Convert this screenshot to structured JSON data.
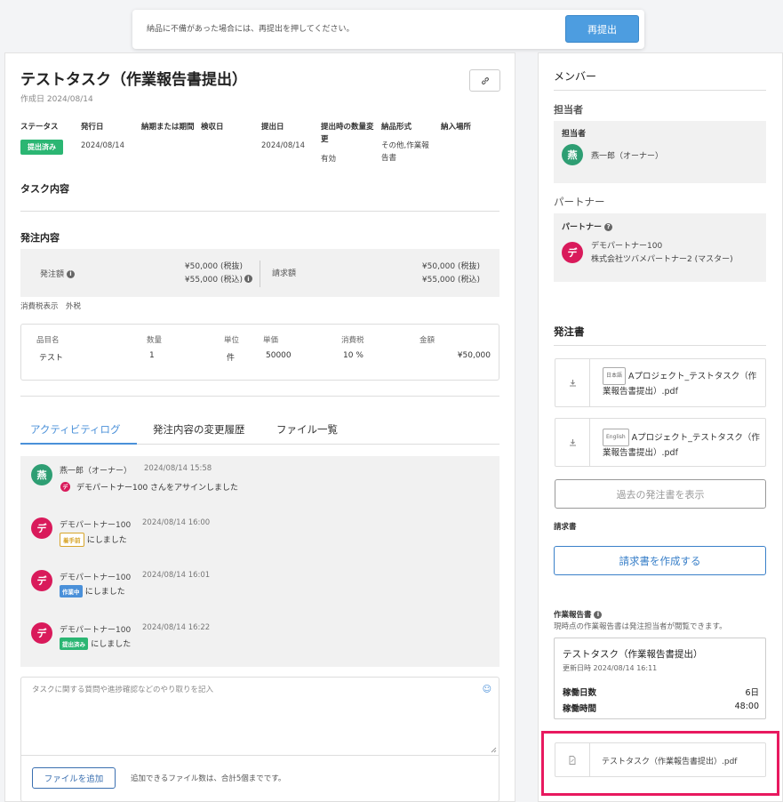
{
  "banner": {
    "message": "納品に不備があった場合には、再提出を押してください。",
    "resubmit_label": "再提出"
  },
  "task": {
    "title": "テストタスク（作業報告書提出）",
    "created": "作成日 2024/08/14",
    "link_icon": "link-icon"
  },
  "info": {
    "headers": {
      "status": "ステータス",
      "issue_date": "発行日",
      "deadline": "納期または期間",
      "inspection_date": "検収日",
      "submit_date": "提出日",
      "qty_change": "提出時の数量変更",
      "format": "納品形式",
      "place": "納入場所"
    },
    "values": {
      "status": "提出済み",
      "issue_date": "2024/08/14",
      "submit_date": "2024/08/14",
      "qty_change": "有効",
      "format": "その他,作業報告書"
    }
  },
  "sections": {
    "task_content": "タスク内容",
    "order_content": "発注内容"
  },
  "order": {
    "order_amount_label": "発注額",
    "order_ex_tax": "¥50,000 (税抜)",
    "order_in_tax": "¥55,000 (税込)",
    "invoice_label": "請求額",
    "invoice_ex_tax": "¥50,000 (税抜)",
    "invoice_in_tax": "¥55,000 (税込)",
    "tax_display": "消費税表示　外税"
  },
  "items": {
    "headers": [
      "品目名",
      "数量",
      "単位",
      "単価",
      "消費税",
      "金額"
    ],
    "rows": [
      [
        "テスト",
        "1",
        "件",
        "50000",
        "10 %",
        "¥50,000"
      ]
    ]
  },
  "tabs": [
    "アクティビティログ",
    "発注内容の変更履歴",
    "ファイル一覧"
  ],
  "activity": [
    {
      "avatar": "燕",
      "name": "燕一郎（オーナー）",
      "time": "2024/08/14 15:58",
      "mini_avatar": "デ",
      "msg": "デモパートナー100 さんをアサインしました"
    },
    {
      "avatar": "デ",
      "name": "デモパートナー100",
      "time": "2024/08/14 16:00",
      "badge": "着手前",
      "msg": "にしました"
    },
    {
      "avatar": "デ",
      "name": "デモパートナー100",
      "time": "2024/08/14 16:01",
      "badge": "作業中",
      "msg": "にしました"
    },
    {
      "avatar": "デ",
      "name": "デモパートナー100",
      "time": "2024/08/14 16:22",
      "badge": "提出済み",
      "msg": "にしました"
    }
  ],
  "comment": {
    "placeholder": "タスクに関する質問や進捗確認などのやり取りを記入",
    "add_file_label": "ファイルを追加",
    "file_limit": "追加できるファイル数は、合計5個までです。",
    "emoji_icon": "smile-icon"
  },
  "sidebar": {
    "members_title": "メンバー",
    "assignee_title": "担当者",
    "assignee_label": "担当者",
    "assignee_avatar": "燕",
    "assignee_name": "燕一郎（オーナー）",
    "partner_title": "パートナー",
    "partner_label": "パートナー",
    "partner_avatar": "デ",
    "partner_name": "デモパートナー100",
    "partner_company": "株式会社ツバメパートナー2 (マスター)",
    "po_title": "発注書",
    "po_docs": [
      {
        "lang": "日本語",
        "name": "Aプロジェクト_テストタスク（作業報告書提出）.pdf"
      },
      {
        "lang": "English",
        "name": "Aプロジェクト_テストタスク（作業報告書提出）.pdf"
      }
    ],
    "past_po_label": "過去の発注書を表示",
    "invoice_title": "請求書",
    "create_invoice_label": "請求書を作成する",
    "report_title": "作業報告書",
    "report_note": "現時点の作業報告書は発注担当者が閲覧できます。",
    "report_card": {
      "title": "テストタスク（作業報告書提出）",
      "updated": "更新日時 2024/08/14 16:11",
      "days_label": "稼働日数",
      "days_value": "6日",
      "hours_label": "稼働時間",
      "hours_value": "48:00"
    },
    "report_file": "テストタスク（作業報告書提出）.pdf"
  },
  "colors": {
    "primary": "#4d9de0",
    "status_submitted": "#2bb673",
    "status_before": "#d7a52b",
    "status_working": "#4a90d9",
    "avatar_green": "#2e9e73",
    "avatar_red": "#d91a5b",
    "highlight": "#e8195f"
  }
}
